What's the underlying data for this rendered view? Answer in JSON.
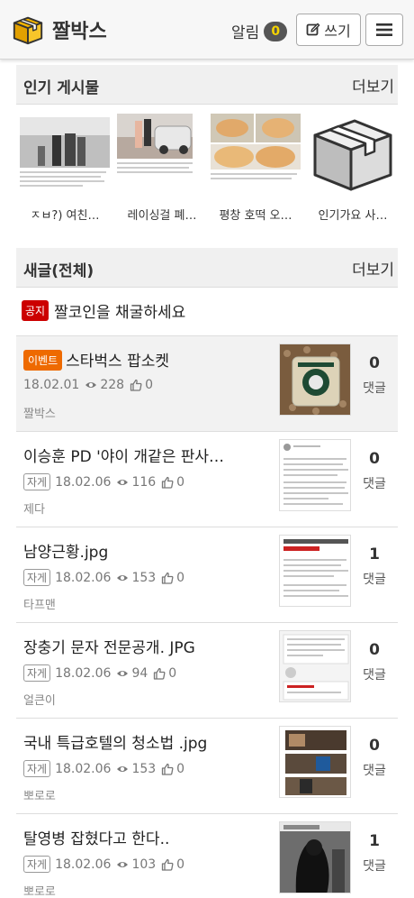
{
  "header": {
    "logo_text": "짤박스",
    "alarm_label": "알림",
    "alarm_count": "0",
    "write_label": "쓰기"
  },
  "popular": {
    "title": "인기 게시물",
    "more": "더보기",
    "items": [
      {
        "title": "ㅈㅂ?) 여친…"
      },
      {
        "title": "레이싱걸 폐…"
      },
      {
        "title": "평창 호떡 오…"
      },
      {
        "title": "인기가요 사…"
      }
    ]
  },
  "new_posts": {
    "title": "새글(전체)",
    "more": "더보기",
    "notice": {
      "badge": "공지",
      "text": "짤코인을 채굴하세요"
    },
    "reply_label": "댓글",
    "items": [
      {
        "badge": "이벤트",
        "category": "",
        "title": "스타벅스 팝소켓",
        "date": "18.02.01",
        "views": "228",
        "likes": "0",
        "author": "짤박스",
        "comments": "0"
      },
      {
        "badge": "",
        "category": "자게",
        "title": "이승훈 PD '야이 개같은 판사…",
        "date": "18.02.06",
        "views": "116",
        "likes": "0",
        "author": "제다",
        "comments": "0"
      },
      {
        "badge": "",
        "category": "자게",
        "title": "남양근황.jpg",
        "date": "18.02.06",
        "views": "153",
        "likes": "0",
        "author": "타프맨",
        "comments": "1"
      },
      {
        "badge": "",
        "category": "자게",
        "title": "장충기 문자 전문공개. JPG",
        "date": "18.02.06",
        "views": "94",
        "likes": "0",
        "author": "얼큰이",
        "comments": "0"
      },
      {
        "badge": "",
        "category": "자게",
        "title": "국내 특급호텔의 청소법 .jpg",
        "date": "18.02.06",
        "views": "153",
        "likes": "0",
        "author": "뽀로로",
        "comments": "0"
      },
      {
        "badge": "",
        "category": "자게",
        "title": "탈영병 잡혔다고 한다..",
        "date": "18.02.06",
        "views": "103",
        "likes": "0",
        "author": "뽀로로",
        "comments": "1"
      }
    ]
  },
  "colors": {
    "event_badge": "#ee6a00",
    "notice_badge": "#cc0000",
    "alarm_badge_bg": "#555555",
    "alarm_badge_fg": "#f5d400"
  }
}
